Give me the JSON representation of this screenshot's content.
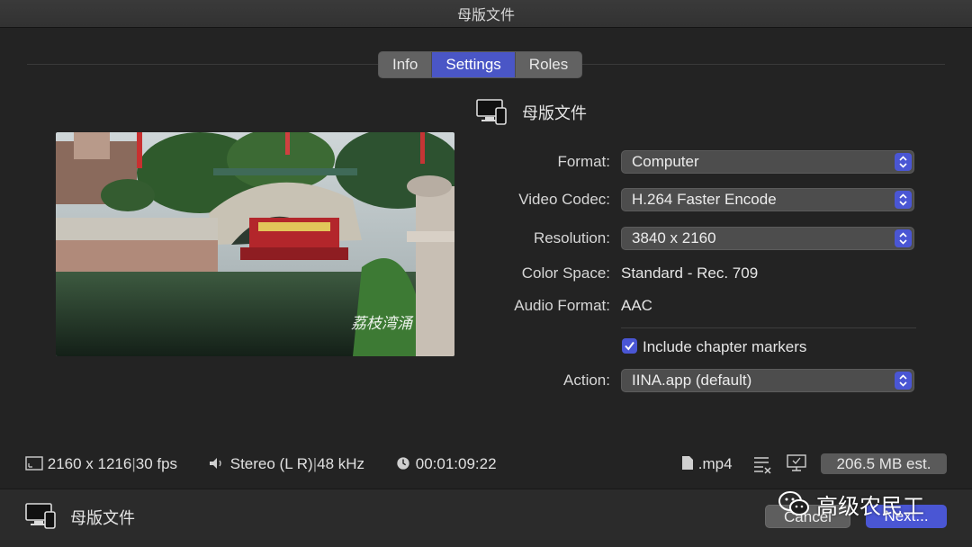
{
  "window": {
    "title": "母版文件"
  },
  "tabs": [
    {
      "label": "Info",
      "active": false
    },
    {
      "label": "Settings",
      "active": true
    },
    {
      "label": "Roles",
      "active": false
    }
  ],
  "preview": {
    "overlay_text": "荔枝湾涌"
  },
  "header": {
    "name": "母版文件",
    "icon": "computer-device-icon"
  },
  "settings": {
    "format": {
      "label": "Format:",
      "value": "Computer"
    },
    "video_codec": {
      "label": "Video Codec:",
      "value": "H.264 Faster Encode"
    },
    "resolution": {
      "label": "Resolution:",
      "value": "3840 x 2160"
    },
    "color_space": {
      "label": "Color Space:",
      "value": "Standard - Rec. 709"
    },
    "audio_format": {
      "label": "Audio Format:",
      "value": "AAC"
    },
    "chapter_markers": {
      "label": "Include chapter markers",
      "checked": true
    },
    "action": {
      "label": "Action:",
      "value": "IINA.app (default)"
    }
  },
  "status": {
    "frame_size": "2160 x 1216",
    "frame_rate": "30 fps",
    "audio_channels": "Stereo (L R)",
    "sample_rate": "48 kHz",
    "duration": "00:01:09:22",
    "file_ext": ".mp4",
    "size_estimate": "206.5 MB est."
  },
  "footer": {
    "name": "母版文件",
    "cancel_label": "Cancel",
    "next_label": "Next..."
  },
  "watermark": {
    "text": "高级农民工"
  },
  "colors": {
    "accent": "#4a56d4",
    "background": "#232323"
  }
}
